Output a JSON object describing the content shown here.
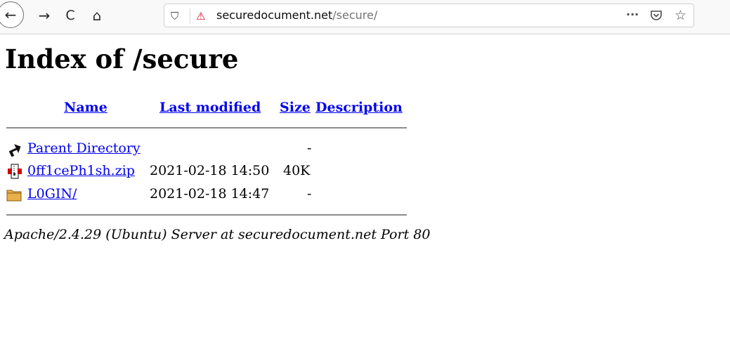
{
  "browser": {
    "url_host": "securedocument.net",
    "url_path": "/secure/",
    "icons": [
      "back-arrow-icon",
      "forward-arrow-icon",
      "reload-icon",
      "home-icon",
      "shield-icon",
      "insecure-lock-icon",
      "more-actions-icon",
      "pocket-icon",
      "bookmark-star-icon"
    ],
    "glyphs": {
      "back": "←",
      "forward": "→",
      "reload": "C",
      "home": "⌂",
      "shield": "⛉",
      "insecure": "⚠",
      "more": "···",
      "pocket": "◡",
      "star": "☆"
    }
  },
  "page": {
    "title": "Index of /secure",
    "columns": {
      "name": "Name",
      "last_modified": "Last modified",
      "size": "Size",
      "description": "Description"
    },
    "rows": [
      {
        "icon": "parent-directory-icon",
        "name": "Parent Directory",
        "modified": "",
        "size": "-"
      },
      {
        "icon": "zip-file-icon",
        "name": "0ff1cePh1sh.zip",
        "modified": "2021-02-18 14:50",
        "size": "40K"
      },
      {
        "icon": "folder-icon",
        "name": "L0GIN/",
        "modified": "2021-02-18 14:47",
        "size": "-"
      }
    ],
    "address": "Apache/2.4.29 (Ubuntu) Server at securedocument.net Port 80"
  }
}
